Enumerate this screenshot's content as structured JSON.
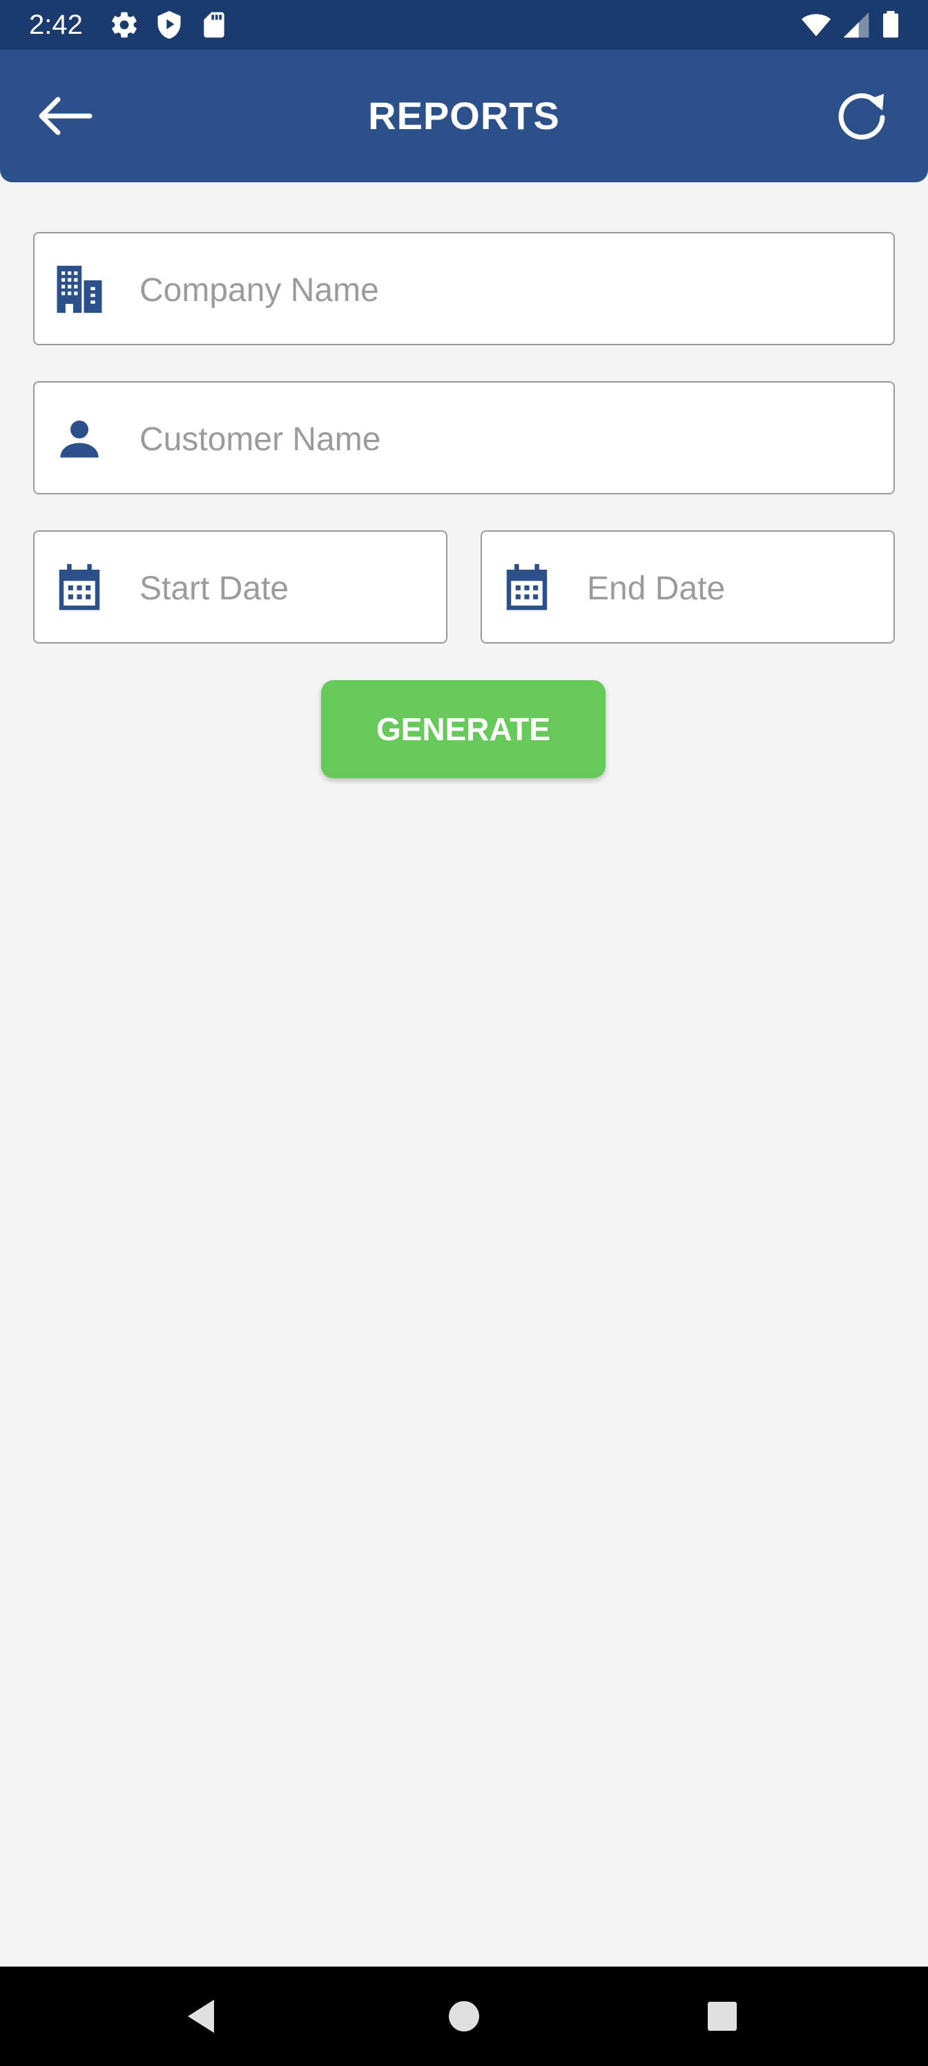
{
  "status_bar": {
    "time": "2:42",
    "left_icons": [
      "gear-icon",
      "shield-play-icon",
      "sd-card-icon"
    ],
    "right_icons": [
      "wifi-icon",
      "cell-signal-icon",
      "battery-icon"
    ]
  },
  "app_bar": {
    "title": "REPORTS",
    "back_icon": "arrow-left-icon",
    "refresh_icon": "refresh-icon",
    "color": "#2c5089"
  },
  "form": {
    "company": {
      "placeholder": "Company Name",
      "value": "",
      "icon": "building-icon"
    },
    "customer": {
      "placeholder": "Customer Name",
      "value": "",
      "icon": "person-icon"
    },
    "start_date": {
      "placeholder": "Start Date",
      "value": "",
      "icon": "calendar-icon"
    },
    "end_date": {
      "placeholder": "End Date",
      "value": "",
      "icon": "calendar-icon"
    },
    "generate_label": "GENERATE",
    "accent": "#66c95a"
  },
  "nav_bar": {
    "icons": [
      "back-triangle-icon",
      "home-circle-icon",
      "recents-square-icon"
    ]
  }
}
